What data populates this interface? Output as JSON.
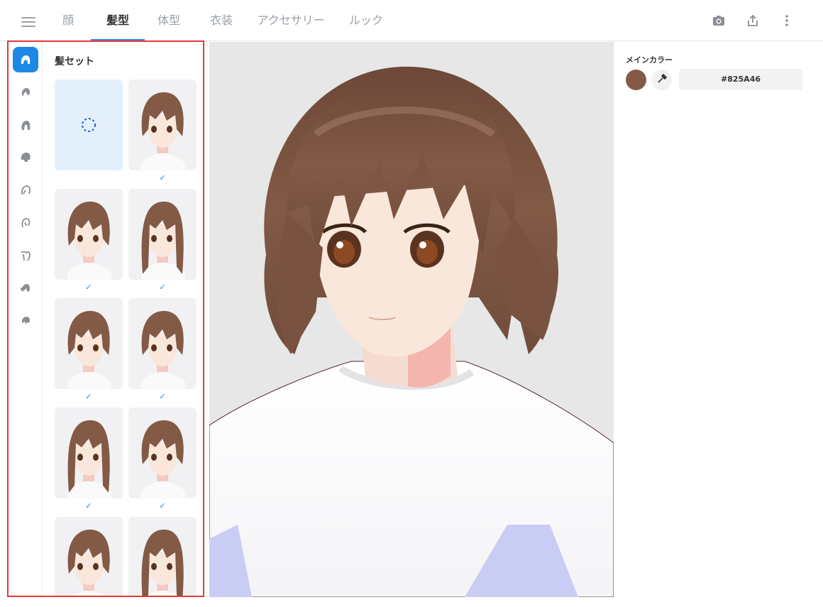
{
  "tabs": [
    {
      "label": "顔"
    },
    {
      "label": "髪型",
      "active": true
    },
    {
      "label": "体型"
    },
    {
      "label": "衣装"
    },
    {
      "label": "アクセサリー"
    },
    {
      "label": "ルック"
    }
  ],
  "top_actions": [
    "camera-icon",
    "share-icon",
    "more-vert-icon"
  ],
  "rail_icons": [
    "hair-set-icon",
    "front-hair-icon",
    "back-hair-icon",
    "full-hair-icon",
    "side-hair-icon",
    "ahoge-icon",
    "hair-accessory-icon",
    "bun-icon",
    "extra-hair-icon"
  ],
  "panel": {
    "title": "髪セット",
    "items": [
      {
        "type": "none",
        "checked": false
      },
      {
        "type": "hair",
        "checked": true
      },
      {
        "type": "hair",
        "checked": true
      },
      {
        "type": "hair",
        "checked": true
      },
      {
        "type": "hair",
        "checked": true
      },
      {
        "type": "hair",
        "checked": true
      },
      {
        "type": "hair",
        "checked": true
      },
      {
        "type": "hair",
        "checked": true
      },
      {
        "type": "hair",
        "checked": false
      },
      {
        "type": "hair",
        "checked": false
      }
    ],
    "check_mark": "✓"
  },
  "right_panel": {
    "label": "メインカラー",
    "hex": "#825A46",
    "color": "#825A46"
  },
  "colors": {
    "accent": "#1e88e5",
    "selection": "#e53935",
    "hair": "#825A46"
  }
}
